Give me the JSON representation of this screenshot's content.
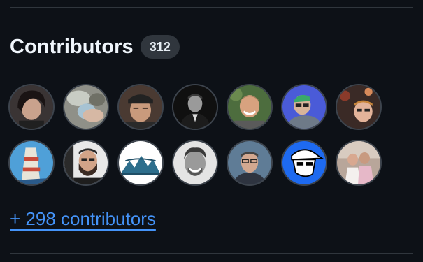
{
  "section": {
    "title": "Contributors",
    "count": "312"
  },
  "avatars": [
    {
      "name": "contributor-avatar-1",
      "icon": "person-photo-dark-hair"
    },
    {
      "name": "contributor-avatar-2",
      "icon": "photo-blurred-hand"
    },
    {
      "name": "contributor-avatar-3",
      "icon": "person-photo-cap"
    },
    {
      "name": "contributor-avatar-4",
      "icon": "person-photo-monochrome"
    },
    {
      "name": "contributor-avatar-5",
      "icon": "person-photo-smiling"
    },
    {
      "name": "contributor-avatar-6",
      "icon": "person-photo-blue-bg"
    },
    {
      "name": "contributor-avatar-7",
      "icon": "person-photo-indoor"
    },
    {
      "name": "contributor-avatar-8",
      "icon": "illustration-drawing"
    },
    {
      "name": "contributor-avatar-9",
      "icon": "person-photo-beard"
    },
    {
      "name": "contributor-avatar-10",
      "icon": "logo-mountain"
    },
    {
      "name": "contributor-avatar-11",
      "icon": "person-photo-grayscale-smile"
    },
    {
      "name": "contributor-avatar-12",
      "icon": "person-photo-glasses"
    },
    {
      "name": "contributor-avatar-13",
      "icon": "cartoon-cap-avatar"
    },
    {
      "name": "contributor-avatar-14",
      "icon": "photo-couple"
    }
  ],
  "more_link": "+ 298 contributors",
  "colors": {
    "background": "#0d1117",
    "divider": "#30363d",
    "badge_bg": "#30363d",
    "link": "#4493f8",
    "text": "#f0f6fc"
  }
}
